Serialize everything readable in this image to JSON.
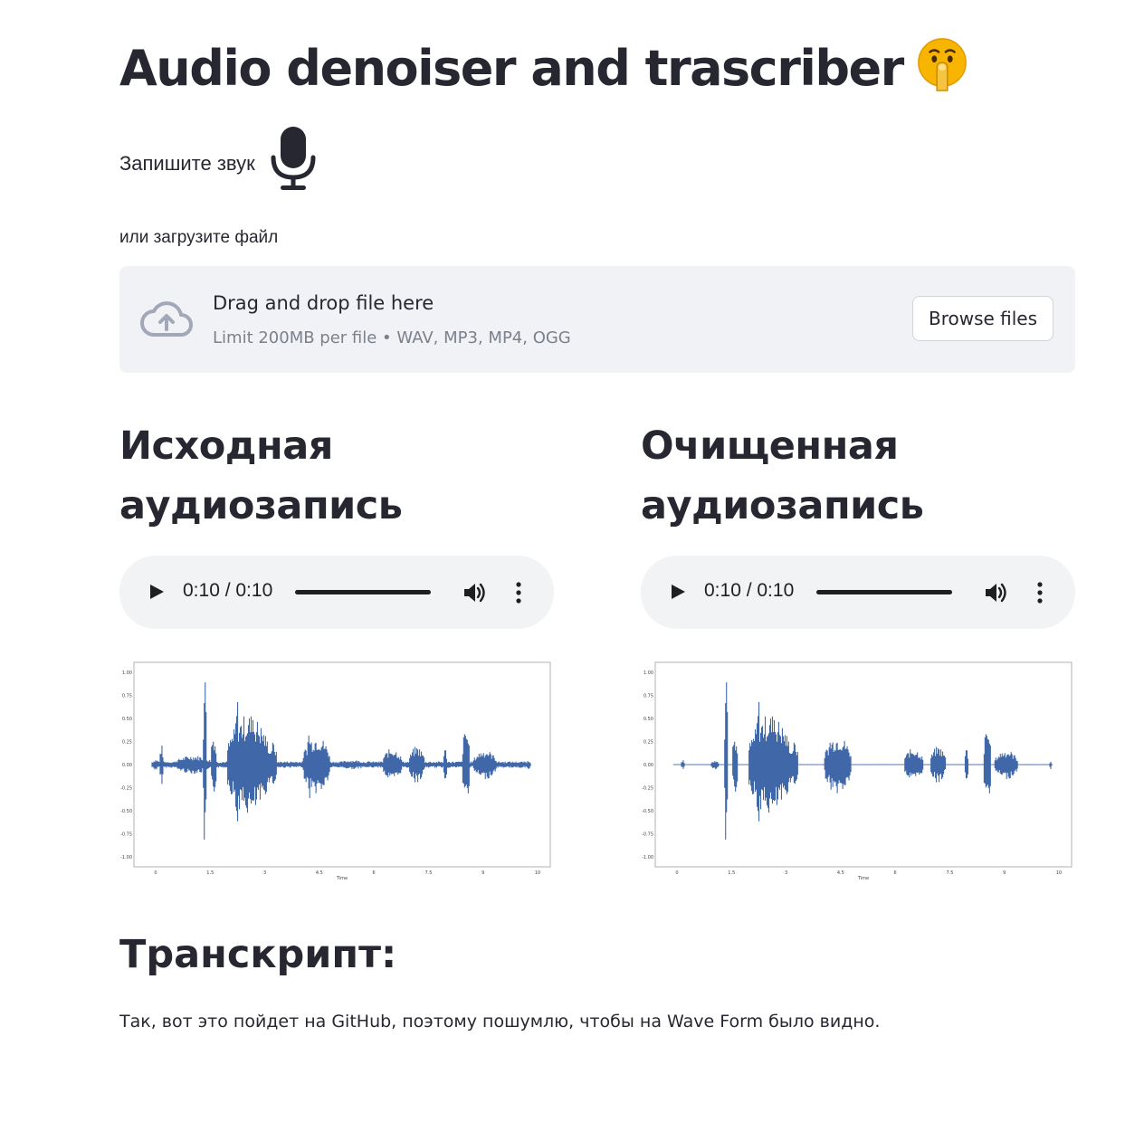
{
  "header": {
    "title": "Audio denoiser and trascriber",
    "title_emoji": "shushing-face-emoji"
  },
  "recorder": {
    "label": "Запишите звук",
    "icon": "microphone-icon"
  },
  "uploader": {
    "label": "или загрузите файл",
    "drop_title": "Drag and drop file here",
    "drop_hint": "Limit 200MB per file • WAV, MP3, MP4, OGG",
    "browse_label": "Browse files",
    "icon": "cloud-upload-icon"
  },
  "original": {
    "heading_line1": "Исходная",
    "heading_line2": "аудиозапись",
    "player": {
      "time": "0:10 / 0:10",
      "progress": 1.0
    },
    "plot": {
      "y_ticks": [
        "1.00",
        "0.75",
        "0.50",
        "0.25",
        "0.00",
        "-0.25",
        "-0.50",
        "-0.75",
        "-1.00"
      ],
      "x_ticks": [
        "0",
        "1.5",
        "3",
        "4.5",
        "6",
        "7.5",
        "9",
        "10"
      ],
      "x_label": "Time"
    }
  },
  "cleaned": {
    "heading_line1": "Очищенная",
    "heading_line2": "аудиозапись",
    "player": {
      "time": "0:10 / 0:10",
      "progress": 1.0
    },
    "plot": {
      "y_ticks": [
        "1.00",
        "0.75",
        "0.50",
        "0.25",
        "0.00",
        "-0.25",
        "-0.50",
        "-0.75",
        "-1.00"
      ],
      "x_ticks": [
        "0",
        "1.5",
        "3",
        "4.5",
        "6",
        "7.5",
        "9",
        "10"
      ],
      "x_label": "Time"
    }
  },
  "transcript": {
    "heading": "Транскрипт:",
    "text": "Так, вот это пойдет на GitHub, поэтому пошумлю, чтобы на Wave Form было видно."
  },
  "colors": {
    "text": "#262730",
    "dropzone_bg": "#f0f2f6",
    "player_bg": "#f1f3f4",
    "waveform": "#4068a8",
    "muted_text": "#7d808b"
  }
}
